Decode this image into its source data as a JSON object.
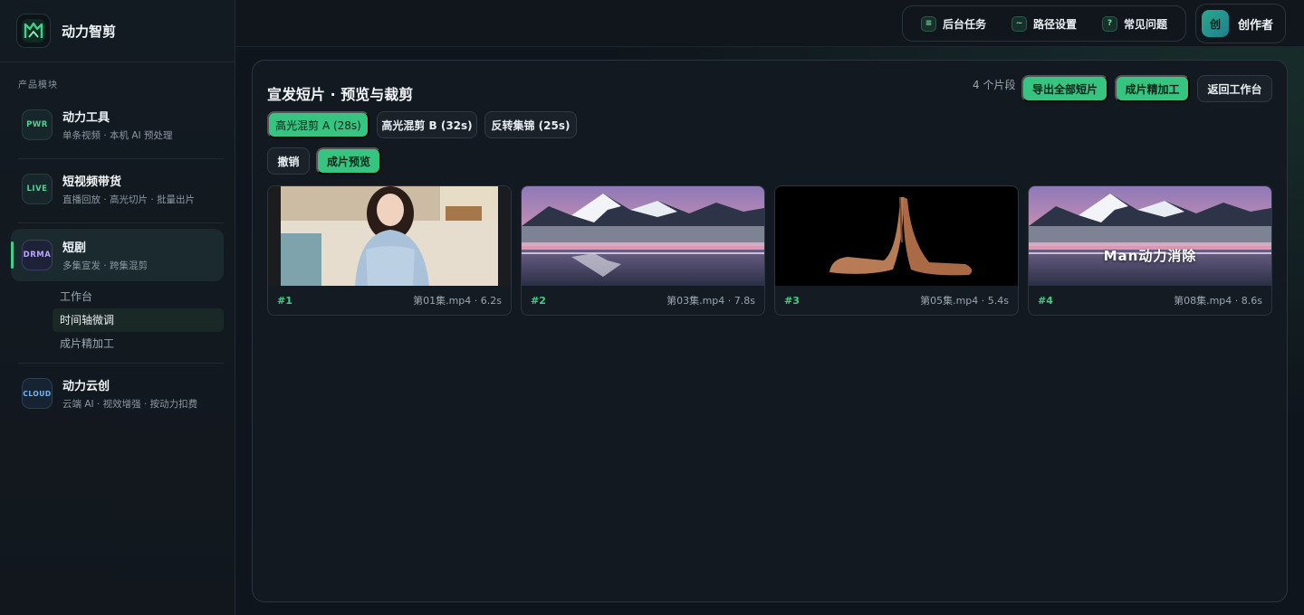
{
  "app": {
    "name": "动力智剪"
  },
  "sidebar": {
    "section_label": "产品模块",
    "modules": [
      {
        "code": "PWR",
        "title": "动力工具",
        "subtitle": "单条视频 · 本机 AI 预处理",
        "color": "#4fd192"
      },
      {
        "code": "LIVE",
        "title": "短视频带货",
        "subtitle": "直播回放 · 高光切片 · 批量出片",
        "color": "#4fd192"
      },
      {
        "code": "DRMA",
        "title": "短剧",
        "subtitle": "多集宣发 · 跨集混剪",
        "color": "#b9a5ff"
      },
      {
        "code": "CLOUD",
        "title": "动力云创",
        "subtitle": "云端 AI · 视效增强 · 按动力扣费",
        "color": "#6fb8ff"
      }
    ],
    "drama_subnav": [
      "工作台",
      "时间轴微调",
      "成片精加工"
    ]
  },
  "topbar": {
    "quick": [
      {
        "icon": "list-icon",
        "glyph": "≡",
        "label": "后台任务"
      },
      {
        "icon": "path-icon",
        "glyph": "~",
        "label": "路径设置"
      },
      {
        "icon": "help-icon",
        "glyph": "?",
        "label": "常见问题"
      }
    ],
    "user": {
      "avatar": "创",
      "name": "创作者"
    }
  },
  "panel": {
    "title": "宣发短片 · 预览与裁剪",
    "segment_count": "4 个片段",
    "actions": {
      "export_all": "导出全部短片",
      "refine": "成片精加工",
      "back": "返回工作台"
    },
    "tabs": [
      "高光混剪 A (28s)",
      "高光混剪 B (32s)",
      "反转集锦 (25s)"
    ],
    "undo": "撤销",
    "preview": "成片预览",
    "clips": [
      {
        "index": "#1",
        "meta": "第01集.mp4 · 6.2s",
        "scene": "woman"
      },
      {
        "index": "#2",
        "meta": "第03集.mp4 · 7.8s",
        "scene": "mountain"
      },
      {
        "index": "#3",
        "meta": "第05集.mp4 · 5.4s",
        "scene": "shoes"
      },
      {
        "index": "#4",
        "meta": "第08集.mp4 · 8.6s",
        "scene": "mountain",
        "overlay": "Man动力消除"
      }
    ]
  },
  "colors": {
    "accent": "#36c580",
    "background": "#0f151c"
  }
}
